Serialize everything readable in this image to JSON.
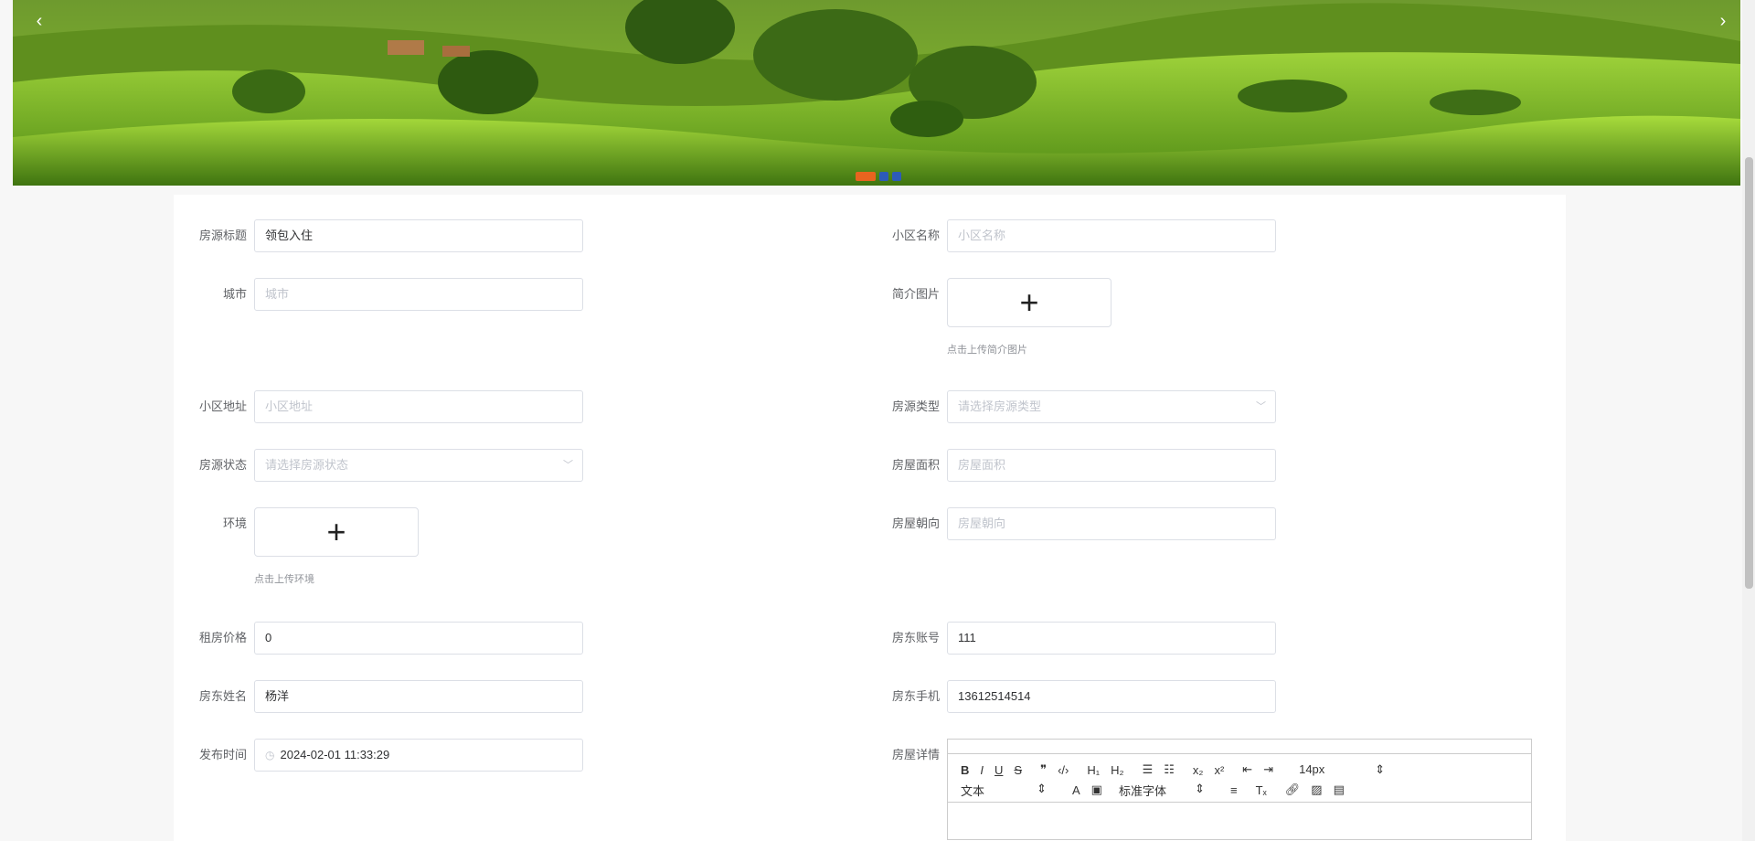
{
  "banner": {
    "prev_label": "‹",
    "next_label": "›",
    "indicator_count": 3,
    "active_index": 0
  },
  "form": {
    "title": {
      "label": "房源标题",
      "value": "领包入住"
    },
    "community": {
      "label": "小区名称",
      "placeholder": "小区名称"
    },
    "city": {
      "label": "城市",
      "placeholder": "城市"
    },
    "cover": {
      "label": "简介图片",
      "tip": "点击上传简介图片"
    },
    "address": {
      "label": "小区地址",
      "placeholder": "小区地址"
    },
    "house_type": {
      "label": "房源类型",
      "placeholder": "请选择房源类型"
    },
    "status": {
      "label": "房源状态",
      "placeholder": "请选择房源状态"
    },
    "area": {
      "label": "房屋面积",
      "placeholder": "房屋面积"
    },
    "environment": {
      "label": "环境",
      "tip": "点击上传环境"
    },
    "orientation": {
      "label": "房屋朝向",
      "placeholder": "房屋朝向"
    },
    "price": {
      "label": "租房价格",
      "value": "0"
    },
    "landlord_account": {
      "label": "房东账号",
      "value": "111"
    },
    "landlord_name": {
      "label": "房东姓名",
      "value": "杨洋"
    },
    "landlord_phone": {
      "label": "房东手机",
      "value": "13612514514"
    },
    "publish_time": {
      "label": "发布时间",
      "value": "2024-02-01 11:33:29"
    },
    "details": {
      "label": "房屋详情"
    }
  },
  "editor": {
    "size_value": "14px",
    "header_value": "文本",
    "font_value": "标准字体"
  },
  "colors": {
    "indicator_active": "#e8641f",
    "indicator": "#2d5bb8"
  }
}
